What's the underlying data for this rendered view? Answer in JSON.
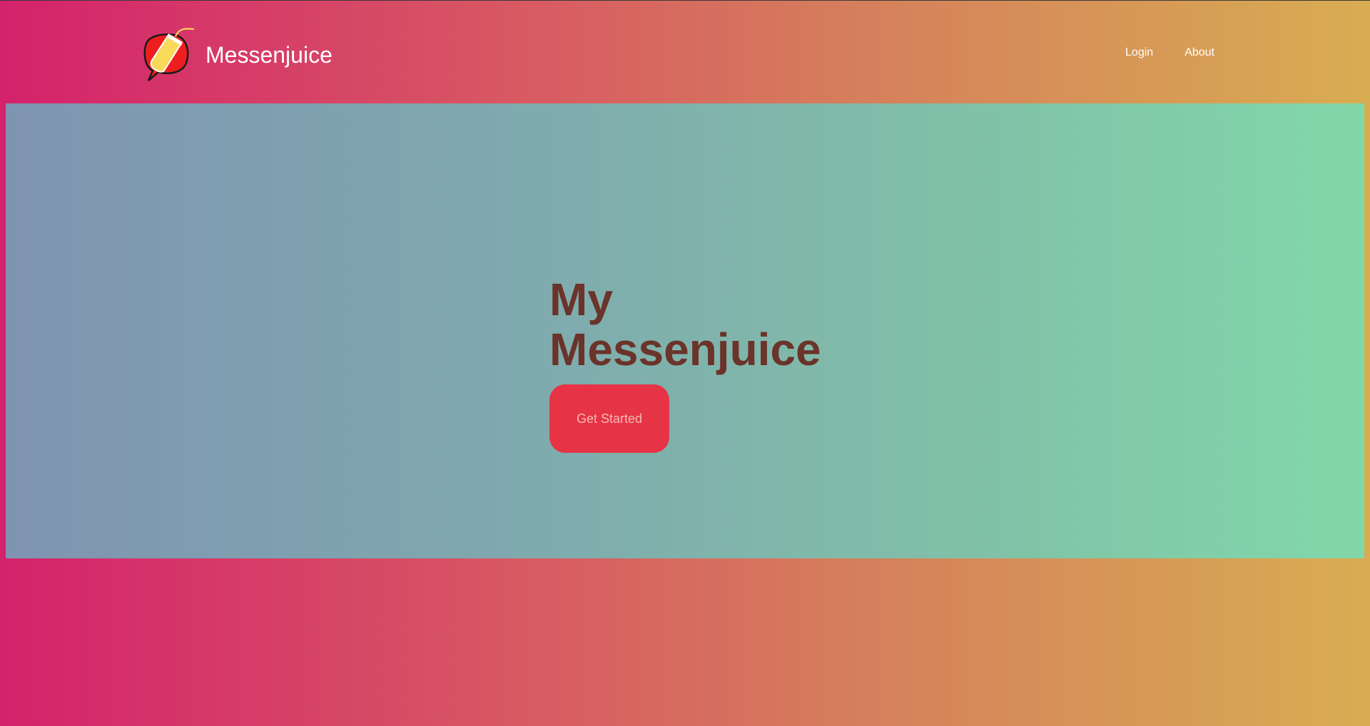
{
  "header": {
    "brand_name": "Messenjuice",
    "nav": {
      "login_label": "Login",
      "about_label": "About"
    }
  },
  "hero": {
    "title_line1": "My",
    "title_line2": "Messenjuice",
    "cta_label": "Get Started"
  },
  "colors": {
    "cta_background": "#e63446",
    "title_text": "#6b3329"
  },
  "icons": {
    "logo": "juice-cup-speech-bubble-icon"
  }
}
